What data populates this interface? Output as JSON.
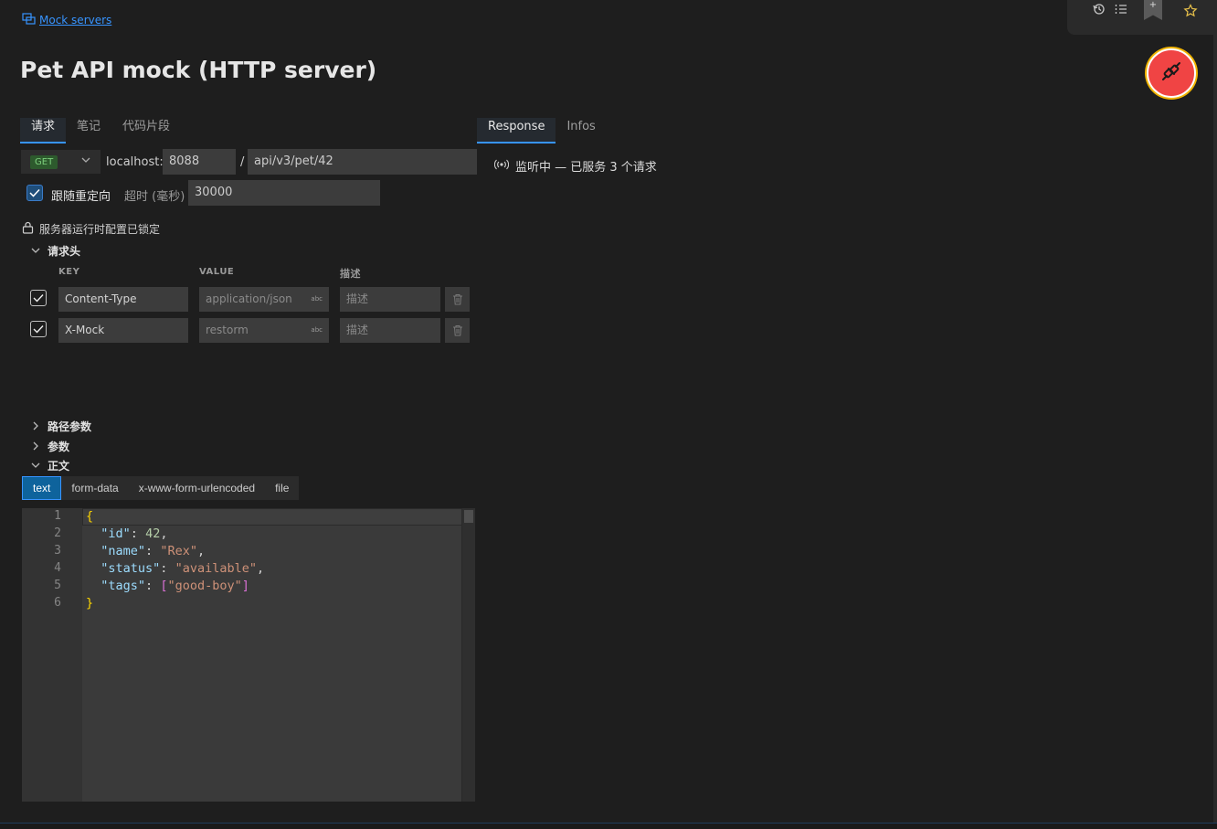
{
  "breadcrumb": {
    "label": "Mock servers",
    "icon": "mock-server-icon"
  },
  "page": {
    "title": "Pet API mock (HTTP server)"
  },
  "left_tabs": [
    {
      "label": "请求",
      "active": true
    },
    {
      "label": "笔记",
      "active": false
    },
    {
      "label": "代码片段",
      "active": false
    }
  ],
  "right_tabs": [
    {
      "label": "Response",
      "active": true
    },
    {
      "label": "Infos",
      "active": false
    }
  ],
  "request": {
    "method": "GET",
    "host_label": "localhost:",
    "port": "8088",
    "path_sep": "/",
    "path": "api/v3/pet/42",
    "follow_redirects_label": "跟随重定向",
    "follow_redirects": true,
    "timeout_label": "超时 (毫秒)",
    "timeout": "30000"
  },
  "lock_notice": "服务器运行时配置已锁定",
  "headers_section": {
    "title": "请求头",
    "expanded": true,
    "columns": [
      "KEY",
      "VALUE",
      "描述"
    ],
    "rows": [
      {
        "enabled": true,
        "key": "Content-Type",
        "value": "application/json",
        "value_type": "abc",
        "description_placeholder": "描述"
      },
      {
        "enabled": true,
        "key": "X-Mock",
        "value": "restorm",
        "value_type": "abc",
        "description_placeholder": "描述"
      }
    ]
  },
  "sections": [
    {
      "title": "路径参数",
      "expanded": false
    },
    {
      "title": "参数",
      "expanded": false
    },
    {
      "title": "正文",
      "expanded": true
    }
  ],
  "body_tabs": [
    {
      "label": "text",
      "active": true
    },
    {
      "label": "form-data",
      "active": false
    },
    {
      "label": "x-www-form-urlencoded",
      "active": false
    },
    {
      "label": "file",
      "active": false
    }
  ],
  "editor": {
    "line_numbers": [
      "1",
      "2",
      "3",
      "4",
      "5",
      "6"
    ],
    "lines": [
      "{",
      "  \"id\": 42,",
      "  \"name\": \"Rex\",",
      "  \"status\": \"available\",",
      "  \"tags\": [\"good-boy\"]",
      "}"
    ]
  },
  "response": {
    "status": "监听中 — 已服务 3 个请求",
    "icon": "broadcast-icon"
  },
  "toolbar": {
    "icons": [
      "history-icon",
      "list-icon",
      "bookmark-icon",
      "star-icon"
    ],
    "bookmark_plus": "+"
  },
  "colors": {
    "accent": "#3794ff",
    "plug_button": "#f04444",
    "plug_ring": "#f0b400",
    "method_get": "#7ccf7c"
  }
}
